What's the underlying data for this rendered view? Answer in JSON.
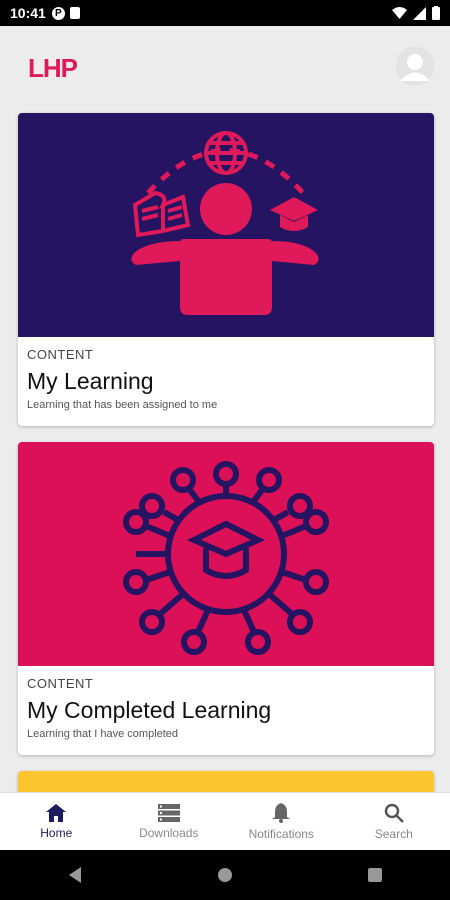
{
  "status": {
    "time": "10:41"
  },
  "app": {
    "logo": "LHP"
  },
  "cards": [
    {
      "overline": "CONTENT",
      "title": "My Learning",
      "subtitle": "Learning that has been assigned to me",
      "bg": "#241461"
    },
    {
      "overline": "CONTENT",
      "title": "My Completed Learning",
      "subtitle": "Learning that I have completed",
      "bg": "#dc1057"
    }
  ],
  "nav": [
    {
      "label": "Home",
      "icon": "home-icon",
      "active": true
    },
    {
      "label": "Downloads",
      "icon": "downloads-icon"
    },
    {
      "label": "Notifications",
      "icon": "bell-icon"
    },
    {
      "label": "Search",
      "icon": "search-icon"
    }
  ],
  "colors": {
    "brand_pink": "#e0195a",
    "brand_navy": "#241461",
    "yellow": "#fdc52f"
  }
}
